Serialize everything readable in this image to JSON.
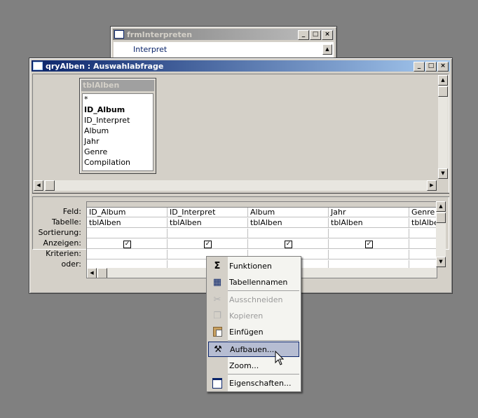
{
  "back_window": {
    "title": "frmInterpreten",
    "field_label": "Interpret",
    "min": "_",
    "max": "□",
    "close": "×"
  },
  "query_window": {
    "title": "qryAlben : Auswahlabfrage",
    "min": "_",
    "max": "□",
    "close": "×",
    "table_box": {
      "title": "tblAlben",
      "fields": [
        "*",
        "ID_Album",
        "ID_Interpret",
        "Album",
        "Jahr",
        "Genre",
        "Compilation"
      ]
    },
    "grid": {
      "row_labels": [
        "Feld:",
        "Tabelle:",
        "Sortierung:",
        "Anzeigen:",
        "Kriterien:",
        "oder:"
      ],
      "columns": [
        {
          "field": "ID_Album",
          "table": "tblAlben",
          "show": "✓"
        },
        {
          "field": "ID_Interpret",
          "table": "tblAlben",
          "show": "✓"
        },
        {
          "field": "Album",
          "table": "tblAlben",
          "show": "✓"
        },
        {
          "field": "Jahr",
          "table": "tblAlben",
          "show": "✓"
        },
        {
          "field": "Genre",
          "table": "tblAlbe",
          "show": ""
        }
      ]
    }
  },
  "context_menu": {
    "items": [
      {
        "label": "Funktionen",
        "icon": "sigma-icon",
        "glyph": "Σ",
        "enabled": true
      },
      {
        "label": "Tabellennamen",
        "icon": "table-names-icon",
        "glyph": "▦",
        "enabled": true
      },
      {
        "label": "Ausschneiden",
        "icon": "scissors-icon",
        "glyph": "✂",
        "enabled": false
      },
      {
        "label": "Kopieren",
        "icon": "copy-icon",
        "glyph": "❐",
        "enabled": false
      },
      {
        "label": "Einfügen",
        "icon": "paste-icon",
        "glyph": "📋",
        "enabled": true
      },
      {
        "label": "Aufbauen...",
        "icon": "build-wand-icon",
        "glyph": "⚒",
        "enabled": true
      },
      {
        "label": "Zoom...",
        "icon": "",
        "glyph": "",
        "enabled": true
      },
      {
        "label": "Eigenschaften...",
        "icon": "properties-icon",
        "glyph": "▤",
        "enabled": true
      }
    ]
  },
  "colors": {
    "desktop": "#808080",
    "active_title": "#0a246a",
    "highlight": "#b6bdd2"
  }
}
